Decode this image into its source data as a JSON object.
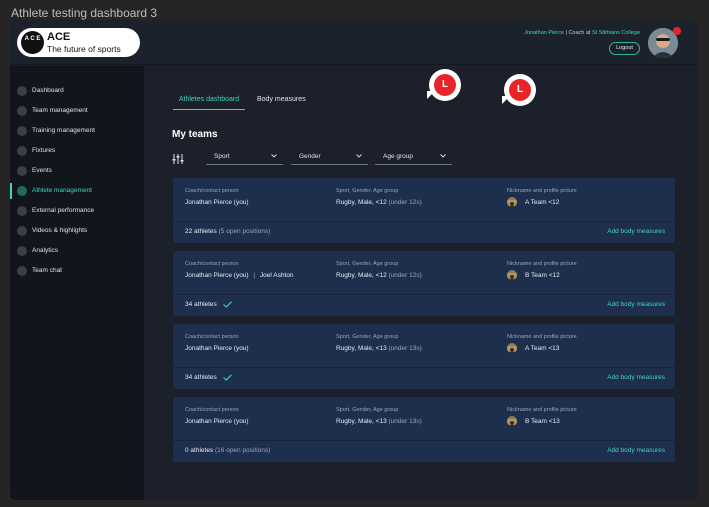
{
  "window_title": "Athlete testing dashboard 3",
  "brand": {
    "name": "ACE",
    "tagline": "The future of sports",
    "mark_text": "A C E"
  },
  "user": {
    "name": "Jonathan Pierce",
    "separator": "| Coach at",
    "org": "St Stithians College",
    "logout_label": "Logout"
  },
  "colors": {
    "accent": "#41d3c0",
    "sidebar": "#12161c",
    "card": "#1e2f4e",
    "badge": "#e8242b"
  },
  "sidebar": {
    "items": [
      {
        "label": "Dashboard"
      },
      {
        "label": "Team management"
      },
      {
        "label": "Training management"
      },
      {
        "label": "Fixtures"
      },
      {
        "label": "Events"
      },
      {
        "label": "Athlete management",
        "active": true
      },
      {
        "label": "External performance"
      },
      {
        "label": "Videos & highlights"
      },
      {
        "label": "Analytics"
      },
      {
        "label": "Team chat"
      }
    ]
  },
  "tabs": [
    {
      "label": "Athletes dashboard",
      "active": true
    },
    {
      "label": "Body measures"
    }
  ],
  "badges": [
    "L",
    "L"
  ],
  "section_title": "My teams",
  "filters": [
    {
      "label": "Sport"
    },
    {
      "label": "Gender"
    },
    {
      "label": "Age group"
    }
  ],
  "column_labels": {
    "coach": "Coach/contact person",
    "sport": "Sport, Gender, Age group",
    "nickname": "Nickname and profile picture"
  },
  "teams": [
    {
      "coach": "Jonathan Pierce (you)",
      "coach2": "",
      "sport": "Rugby,",
      "gender": "Male,",
      "age": "<12",
      "age_note": "(under 12s)",
      "nickname": "A Team <12",
      "athletes": "22 athletes",
      "athletes_note": "(5 open positions)",
      "complete": false,
      "add_label": "Add body measures"
    },
    {
      "coach": "Jonathan Pierce (you)",
      "coach2": "Joel Ashton",
      "sport": "Rugby,",
      "gender": "Male,",
      "age": "<12",
      "age_note": "(under 12s)",
      "nickname": "B Team <12",
      "athletes": "34 athletes",
      "athletes_note": "",
      "complete": true,
      "add_label": "Add body measures"
    },
    {
      "coach": "Jonathan Pierce (you)",
      "coach2": "",
      "sport": "Rugby,",
      "gender": "Male,",
      "age": "<13",
      "age_note": "(under 13s)",
      "nickname": "A Team <13",
      "athletes": "34 athletes",
      "athletes_note": "",
      "complete": true,
      "add_label": "Add body measures"
    },
    {
      "coach": "Jonathan Pierce (you)",
      "coach2": "",
      "sport": "Rugby,",
      "gender": "Male,",
      "age": "<13",
      "age_note": "(under 13s)",
      "nickname": "B Team <13",
      "athletes": "0 athletes",
      "athletes_note": "(16 open positions)",
      "complete": false,
      "add_label": "Add body measures"
    }
  ]
}
